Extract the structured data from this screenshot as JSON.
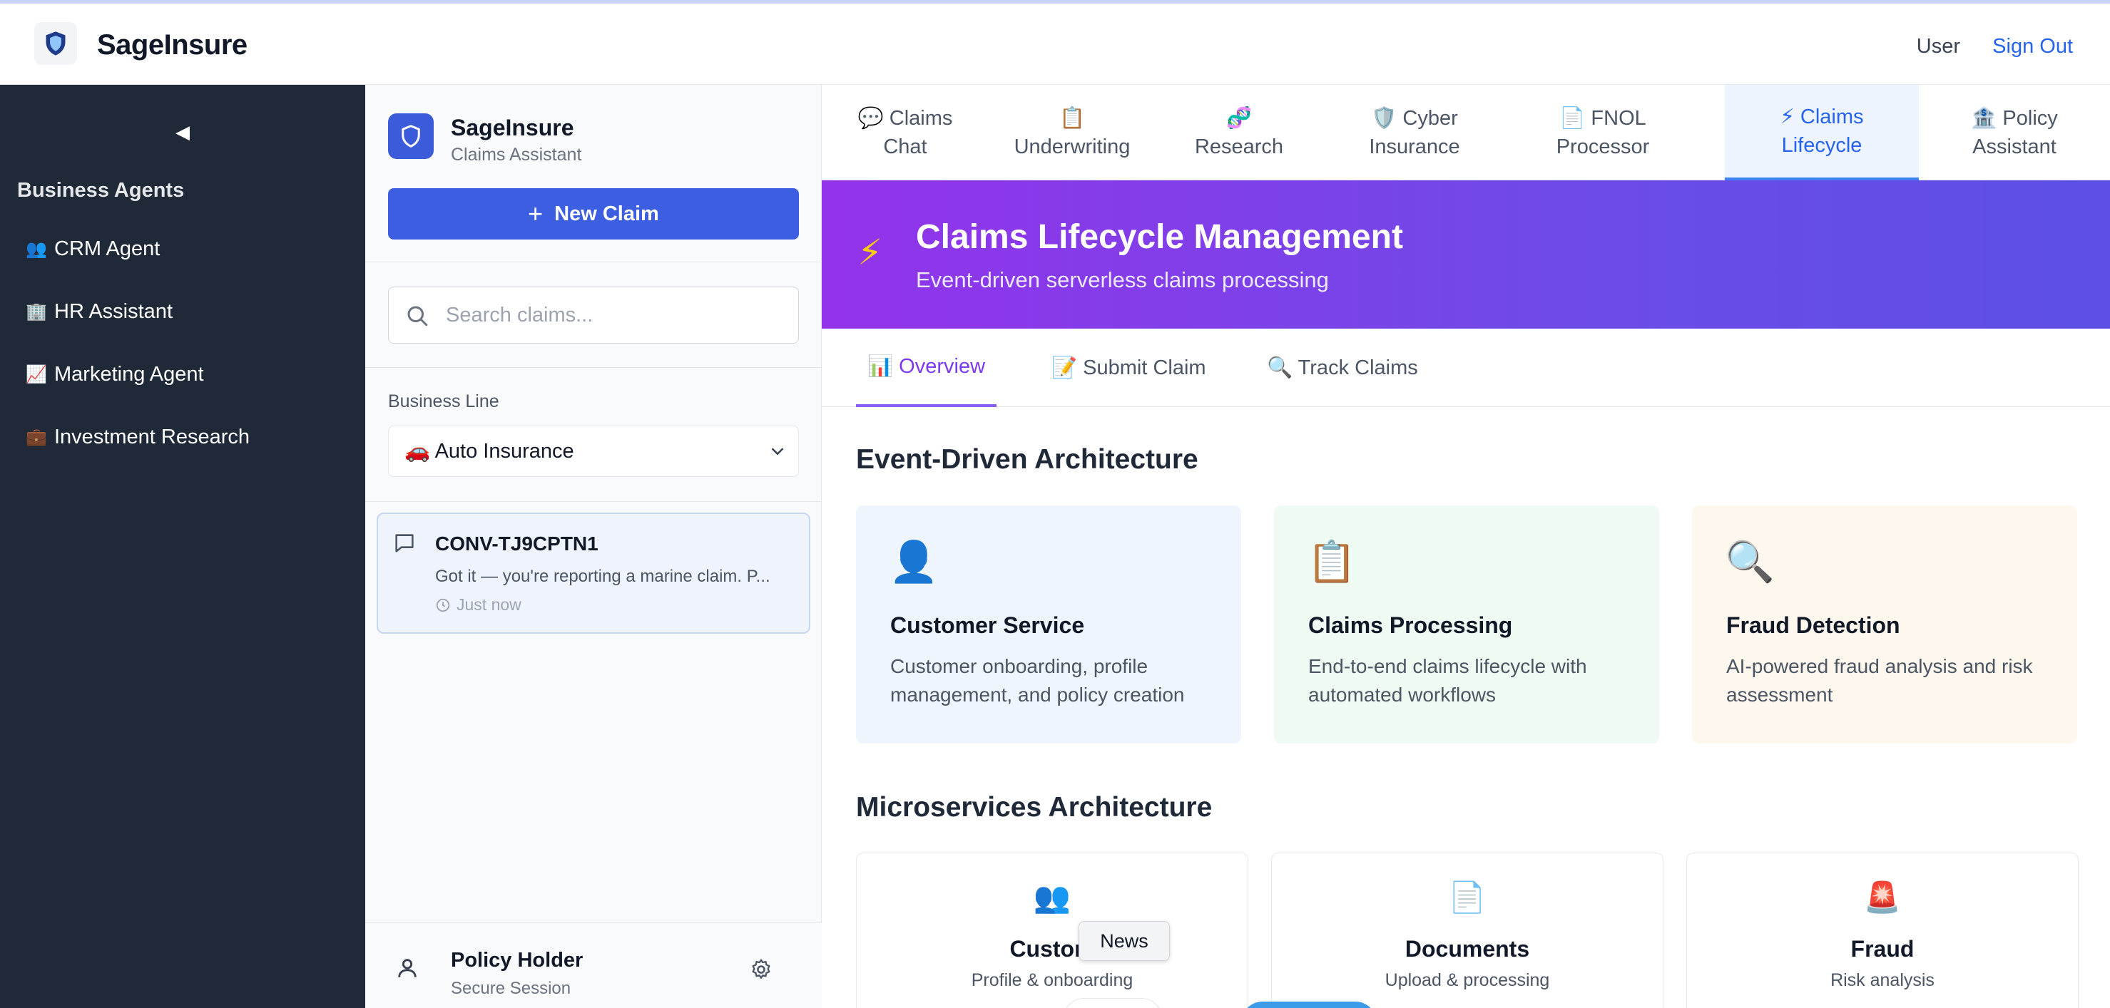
{
  "header": {
    "brand_name": "SageInsure",
    "user_label": "User",
    "sign_out_label": "Sign Out"
  },
  "agents_sidebar": {
    "collapse_icon": "◀",
    "title": "Business Agents",
    "items": [
      {
        "emoji": "👥",
        "label": "CRM Agent"
      },
      {
        "emoji": "🏢",
        "label": "HR Assistant"
      },
      {
        "emoji": "📈",
        "label": "Marketing Agent"
      },
      {
        "emoji": "💼",
        "label": "Investment Research"
      }
    ]
  },
  "claims_panel": {
    "title": "SageInsure",
    "subtitle": "Claims Assistant",
    "new_claim_label": "New Claim",
    "search_placeholder": "Search claims...",
    "business_line_label": "Business Line",
    "business_line_value": "🚗 Auto Insurance",
    "conversations": [
      {
        "id": "CONV-TJ9CPTN1",
        "snippet": "Got it — you're reporting a marine claim. P...",
        "time": "Just now"
      }
    ],
    "footer": {
      "name": "Policy Holder",
      "subtitle": "Secure Session"
    }
  },
  "tabs": [
    {
      "icon": "💬",
      "line1": "Claims",
      "line2": "Chat"
    },
    {
      "icon": "📋",
      "line1": "",
      "line2": "Underwriting"
    },
    {
      "icon": "🧬",
      "line1": "",
      "line2": "Research"
    },
    {
      "icon": "🛡️",
      "line1": "Cyber",
      "line2": "Insurance"
    },
    {
      "icon": "📄",
      "line1": "FNOL",
      "line2": "Processor"
    },
    {
      "icon": "⚡",
      "line1": "Claims",
      "line2": "Lifecycle"
    },
    {
      "icon": "🏦",
      "line1": "Policy",
      "line2": "Assistant"
    }
  ],
  "hero": {
    "icon": "⚡",
    "title": "Claims Lifecycle Management",
    "subtitle": "Event-driven serverless claims processing"
  },
  "subtabs": [
    {
      "label": "📊 Overview"
    },
    {
      "label": "📝 Submit Claim"
    },
    {
      "label": "🔍 Track Claims"
    }
  ],
  "sections": {
    "event_driven_title": "Event-Driven Architecture",
    "microservices_title": "Microservices Architecture"
  },
  "arch_cards": [
    {
      "icon": "👤",
      "title": "Customer Service",
      "desc": "Customer onboarding, profile management, and policy creation",
      "bg": "#eef5fd"
    },
    {
      "icon": "📋",
      "title": "Claims Processing",
      "desc": "End-to-end claims lifecycle with automated workflows",
      "bg": "#effaf2"
    },
    {
      "icon": "🔍",
      "title": "Fraud Detection",
      "desc": "AI-powered fraud analysis and risk assessment",
      "bg": "#fef7ee"
    }
  ],
  "ms_cards": [
    {
      "icon": "👥",
      "title": "Custom",
      "desc": "Profile & onboarding"
    },
    {
      "icon": "📄",
      "title": "Documents",
      "desc": "Upload & processing"
    },
    {
      "icon": "🚨",
      "title": "Fraud",
      "desc": "Risk analysis"
    }
  ],
  "tooltip": "News",
  "colors": {
    "accent": "#3b5fe0",
    "sidebar_bg": "#1f2937",
    "hero_start": "#9333ea",
    "hero_end": "#5b4fe5"
  }
}
